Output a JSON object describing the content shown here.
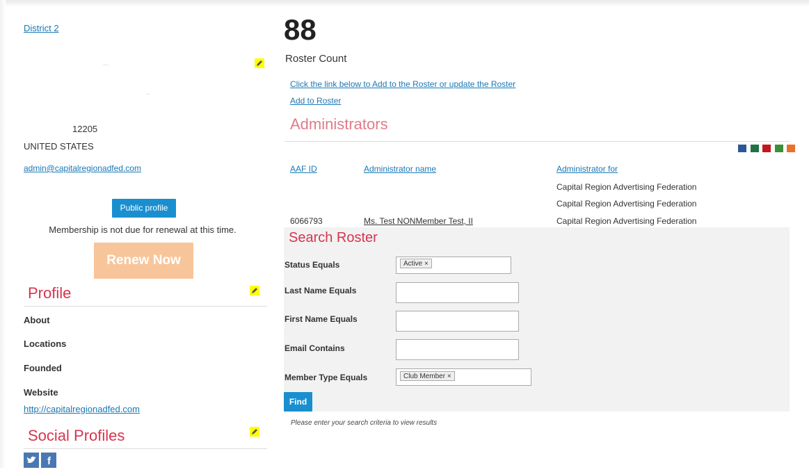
{
  "sidebar": {
    "district_link": "District 2",
    "zip": "12205",
    "country": "UNITED STATES",
    "email": "admin@capitalregionadfed.com",
    "public_profile_button": "Public profile",
    "renewal_status": "Membership is not due for renewal at this time.",
    "renew_button": "Renew Now",
    "profile_title": "Profile",
    "profile_items": {
      "about": "About",
      "locations": "Locations",
      "founded": "Founded",
      "website_label": "Website",
      "website_url": "http://capitalregionadfed.com"
    },
    "social_title": "Social Profiles",
    "social_icons": [
      "twitter-icon",
      "facebook-icon"
    ]
  },
  "main": {
    "roster_count": "88",
    "roster_count_label": "Roster Count",
    "instruction_link": "Click the link below to Add to the Roster or update the Roster",
    "add_link": "Add to Roster",
    "admins_title": "Administrators",
    "export_icons": [
      "word-icon",
      "excel-icon",
      "pdf-icon",
      "csv-icon",
      "xml-icon"
    ],
    "admin_table": {
      "headers": [
        "AAF ID",
        "Administrator name",
        "Administrator for"
      ],
      "rows": [
        {
          "id": "",
          "name": "",
          "for": "Capital Region Advertising Federation"
        },
        {
          "id": "",
          "name": "",
          "for": "Capital Region Advertising Federation"
        },
        {
          "id": "6066793",
          "name": "Ms. Test NONMember Test, II",
          "for": "Capital Region Advertising Federation"
        }
      ]
    },
    "search": {
      "title": "Search Roster",
      "status_label": "Status Equals",
      "status_tag": "Active",
      "last_name_label": "Last Name Equals",
      "first_name_label": "First Name Equals",
      "email_label": "Email Contains",
      "member_type_label": "Member Type Equals",
      "member_type_tag": "Club Member",
      "find_button": "Find",
      "hint": "Please enter your search criteria to view results"
    }
  },
  "colors": {
    "accent_red": "#d6344f",
    "link_blue": "#1a78b4",
    "button_blue": "#1a8fd0",
    "renew_orange": "#f8c59a",
    "highlight_yellow": "#ffff00",
    "search_panel_bg": "#f2f2f2"
  }
}
